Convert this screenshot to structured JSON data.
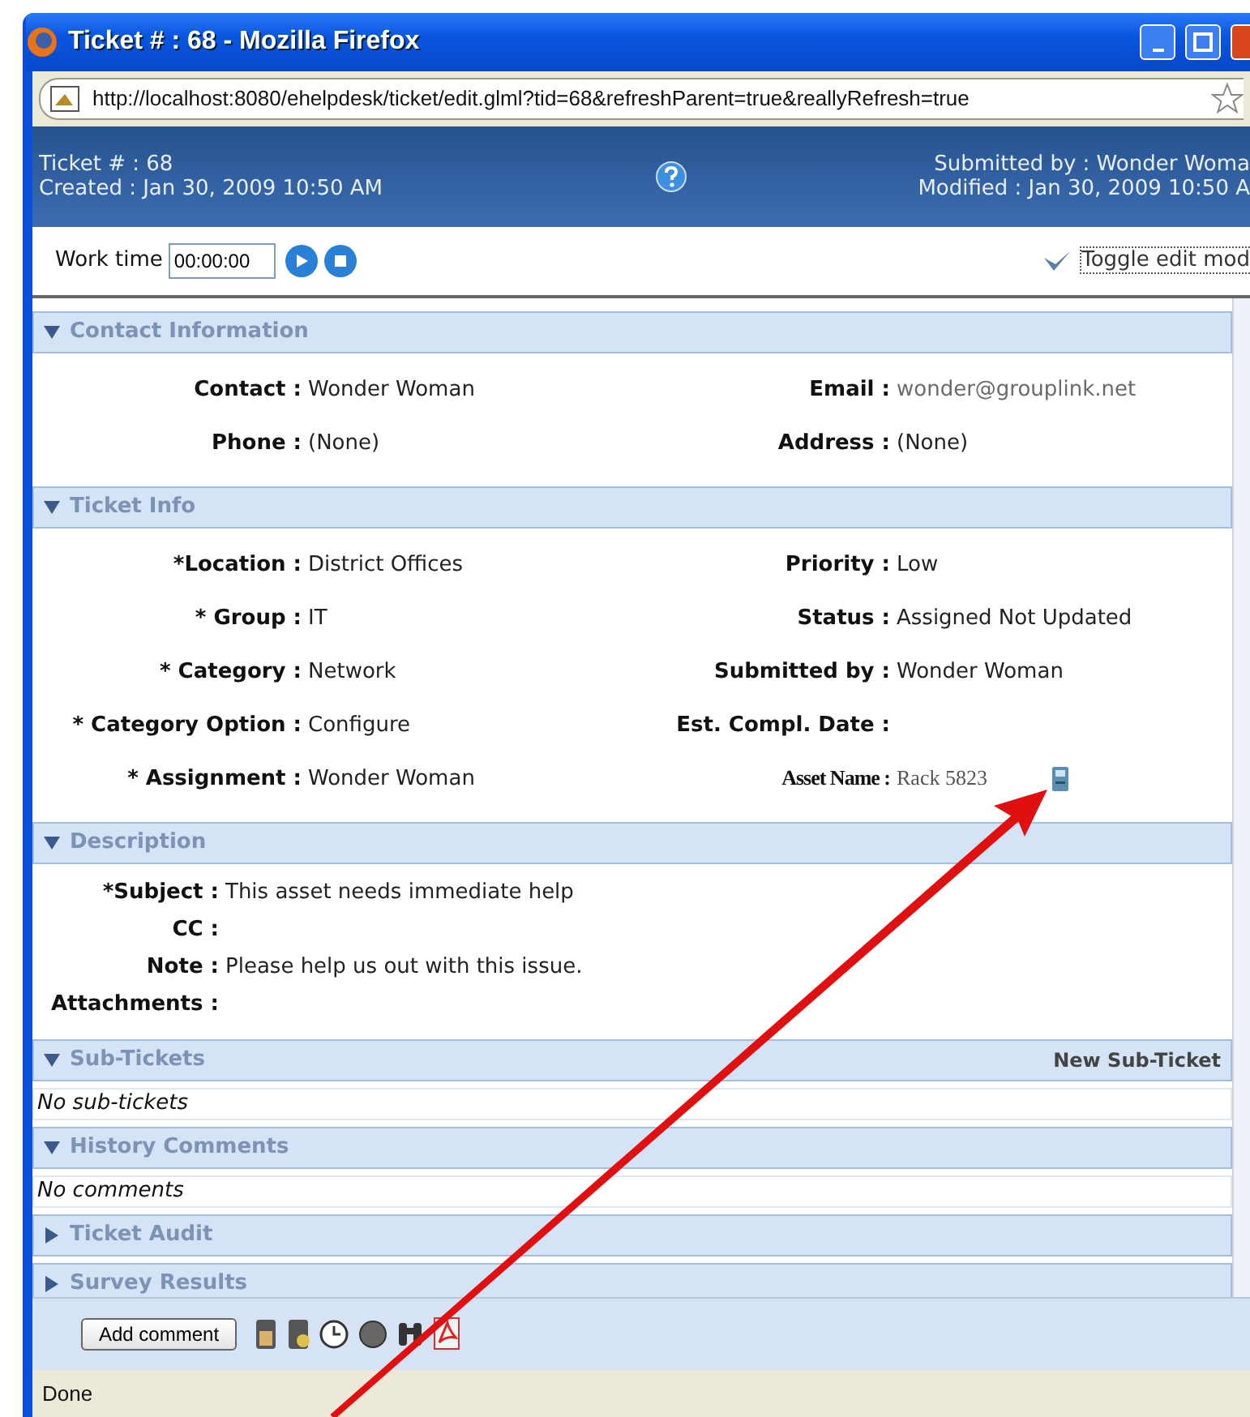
{
  "window": {
    "title": "Ticket # : 68 - Mozilla Firefox"
  },
  "address_bar": {
    "url": "http://localhost:8080/ehelpdesk/ticket/edit.glml?tid=68&refreshParent=true&reallyRefresh=true"
  },
  "header": {
    "left": [
      "Ticket # : 68",
      "Created : Jan 30, 2009 10:50 AM"
    ],
    "right": [
      "Submitted by : Wonder Woma",
      "Modified : Jan 30, 2009 10:50 A"
    ]
  },
  "work_time": {
    "label": "Work time",
    "value": "00:00:00",
    "toggle": "Toggle edit mod"
  },
  "sections": [
    {
      "title": "Contact Information",
      "expanded": true,
      "kind": "fields",
      "rows": [
        [
          {
            "label": "Contact :",
            "value": "Wonder Woman"
          },
          {
            "label": "Email :",
            "value": "wonder@grouplink.net",
            "kind": "muted"
          }
        ],
        [
          {
            "label": "Phone :",
            "value": "(None)"
          },
          {
            "label": "Address :",
            "value": "(None)"
          }
        ]
      ]
    },
    {
      "title": "Ticket Info",
      "expanded": true,
      "kind": "fields",
      "rows": [
        [
          {
            "label": "*Location :",
            "value": "District Offices"
          },
          {
            "label": "Priority :",
            "value": "Low"
          }
        ],
        [
          {
            "label": "* Group :",
            "value": "IT"
          },
          {
            "label": "Status :",
            "value": "Assigned Not Updated"
          }
        ],
        [
          {
            "label": "* Category :",
            "value": "Network"
          },
          {
            "label": "Submitted by :",
            "value": "Wonder Woman"
          }
        ],
        [
          {
            "label": "* Category Option :",
            "value": "Configure"
          },
          {
            "label": "Est. Compl. Date :"
          }
        ],
        [
          {
            "label": "* Assignment :",
            "value": "Wonder Woman"
          },
          {
            "label": "Asset Name :",
            "value": "Rack 5823",
            "kind": "asset"
          }
        ]
      ]
    },
    {
      "title": "Description",
      "expanded": true,
      "kind": "description",
      "rows": [
        {
          "label": "*Subject :",
          "value": "This asset needs immediate help"
        },
        {
          "label": "CC :"
        },
        {
          "label": "Note :",
          "value": "Please help us out with this issue."
        },
        {
          "label": "Attachments :"
        }
      ]
    },
    {
      "title": "Sub-Tickets",
      "expanded": true,
      "kind": "list",
      "action": "New Sub-Ticket",
      "empty": "No sub-tickets"
    },
    {
      "title": "History Comments",
      "expanded": true,
      "kind": "list",
      "empty": "No comments"
    },
    {
      "title": "Ticket Audit",
      "expanded": false
    },
    {
      "title": "Survey Results",
      "expanded": false
    }
  ],
  "footer": {
    "button": "Add comment"
  },
  "status_bar": {
    "text": "Done"
  }
}
